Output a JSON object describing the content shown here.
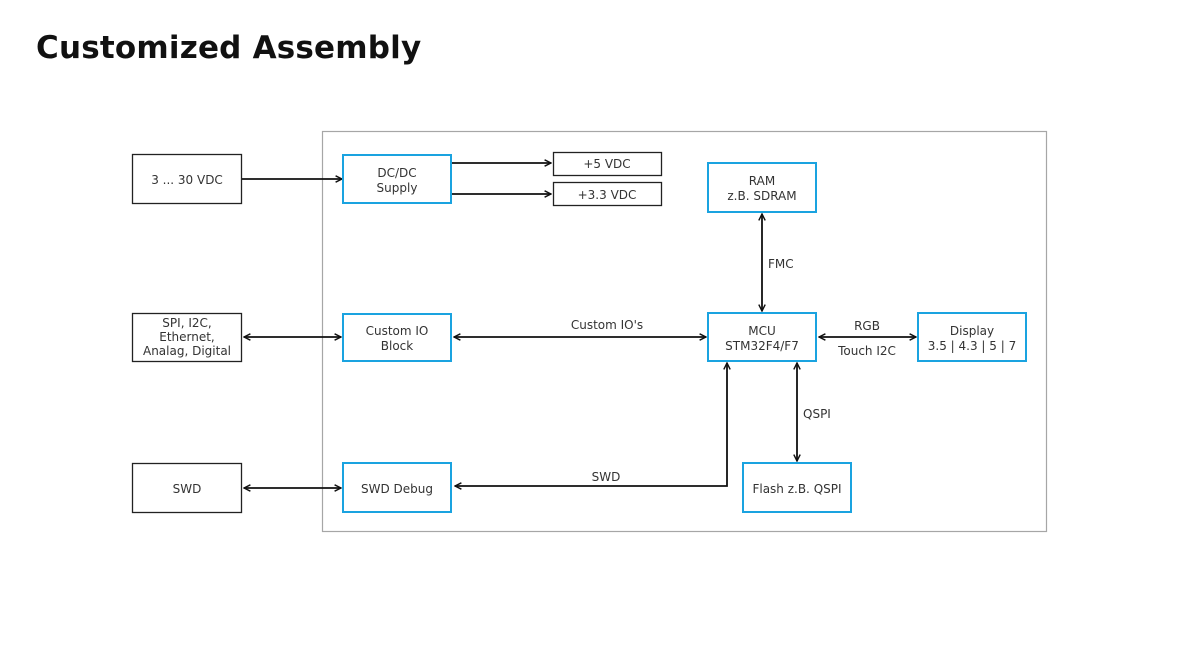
{
  "page": {
    "title": "Customized Assembly"
  },
  "colors": {
    "internal_block_border": "#1aa3e0",
    "external_block_border": "#222222",
    "frame_border": "#a6a6a6",
    "connector": "#111111"
  },
  "external_blocks": {
    "power_input": [
      "3 ... 30 VDC"
    ],
    "io_interfaces": [
      "SPI, I2C,",
      "Ethernet,",
      "Analag, Digital"
    ],
    "swd": [
      "SWD"
    ]
  },
  "internal_blocks": {
    "dcdc": [
      "DC/DC",
      "Supply"
    ],
    "custom_io": [
      "Custom IO",
      "Block"
    ],
    "swd_debug": [
      "SWD Debug"
    ],
    "ram": [
      "RAM",
      "z.B. SDRAM"
    ],
    "mcu": [
      "MCU",
      "STM32F4/F7"
    ],
    "flash": [
      "Flash z.B. QSPI"
    ],
    "display": [
      "Display",
      "3.5 | 4.3 | 5 | 7"
    ]
  },
  "outputs": {
    "v5": [
      "+5 VDC"
    ],
    "v33": [
      "+3.3 VDC"
    ]
  },
  "connection_labels": {
    "custom_ios": "Custom IO's",
    "fmc": "FMC",
    "rgb": "RGB",
    "touch": "Touch I2C",
    "qspi": "QSPI",
    "swd": "SWD"
  }
}
